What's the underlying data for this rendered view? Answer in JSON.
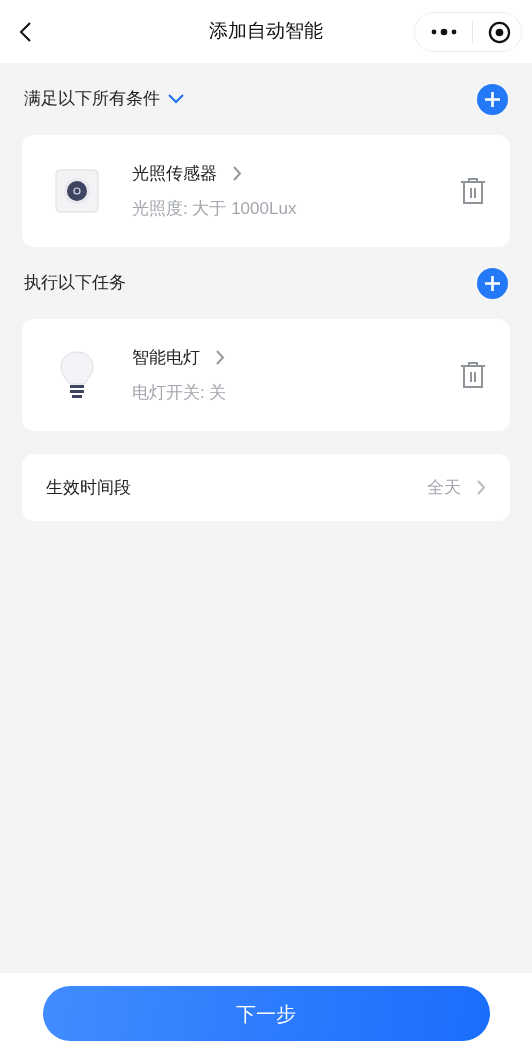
{
  "header": {
    "title": "添加自动智能"
  },
  "sections": [
    {
      "title": "满足以下所有条件",
      "has_dropdown": true,
      "items": [
        {
          "kind": "sensor",
          "name": "光照传感器",
          "detail": "光照度: 大于 1000Lux"
        }
      ]
    },
    {
      "title": "执行以下任务",
      "has_dropdown": false,
      "items": [
        {
          "kind": "bulb",
          "name": "智能电灯",
          "detail": "电灯开关: 关"
        }
      ]
    }
  ],
  "schedule": {
    "label": "生效时间段",
    "value": "全天"
  },
  "footer": {
    "button": "下一步"
  }
}
